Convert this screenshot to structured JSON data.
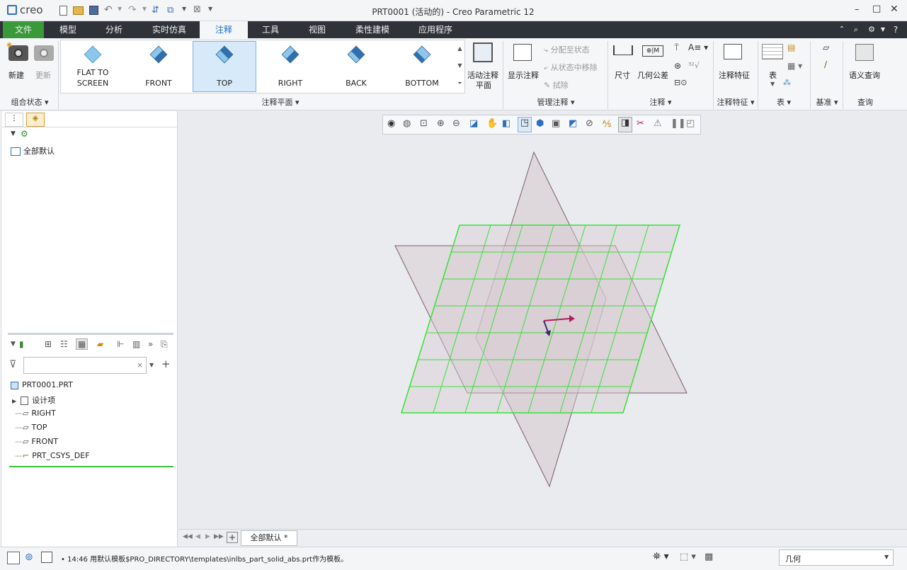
{
  "titlebar": {
    "logo": "creo",
    "title": "PRT0001 (活动的) - Creo Parametric 12"
  },
  "menu": {
    "tabs": [
      "文件",
      "模型",
      "分析",
      "实时仿真",
      "注释",
      "工具",
      "视图",
      "柔性建模",
      "应用程序"
    ],
    "active": "注释"
  },
  "ribbon": {
    "new_label": "新建",
    "update_label": "更新",
    "combo_state_label": "组合状态",
    "gallery": [
      {
        "line1": "FLAT TO",
        "line2": "SCREEN"
      },
      {
        "line1": "",
        "line2": "FRONT"
      },
      {
        "line1": "",
        "line2": "TOP"
      },
      {
        "line1": "",
        "line2": "RIGHT"
      },
      {
        "line1": "",
        "line2": "BACK"
      },
      {
        "line1": "",
        "line2": "BOTTOM"
      }
    ],
    "annotation_plane_label": "注释平面",
    "active_plane_line1": "活动注释",
    "active_plane_line2": "平面",
    "show_annotation": "显示注释",
    "assign_state": "分配至状态",
    "remove_from_state": "从状态中移除",
    "erase": "拭除",
    "manage_label": "管理注释",
    "dimension": "尺寸",
    "gtol": "几何公差",
    "annotation_label": "注释",
    "annotation_feature": "注释特征",
    "annotation_feature_group": "注释特征",
    "table": "表",
    "table_group": "表",
    "datum_group": "基准",
    "semantic_query": "语义查询",
    "query_group": "查询"
  },
  "left_panel": {
    "layer_item": "全部默认",
    "search_placeholder": "",
    "tree": [
      "PRT0001.PRT",
      "设计项",
      "RIGHT",
      "TOP",
      "FRONT",
      "PRT_CSYS_DEF"
    ]
  },
  "bottom_tab": "全部默认 *",
  "status": {
    "message": "14:46 用默认模板$PRO_DIRECTORY\\templates\\inlbs_part_solid_abs.prt作为模板。",
    "filter_value": "几何"
  },
  "colors": {
    "menubar": "#2f3339",
    "file_tab": "#3a9a3a",
    "grid": "#36e236",
    "plane_fill": "#d8cdd2",
    "plane_edge": "#7a5e68",
    "csys": "#b01d5c"
  }
}
